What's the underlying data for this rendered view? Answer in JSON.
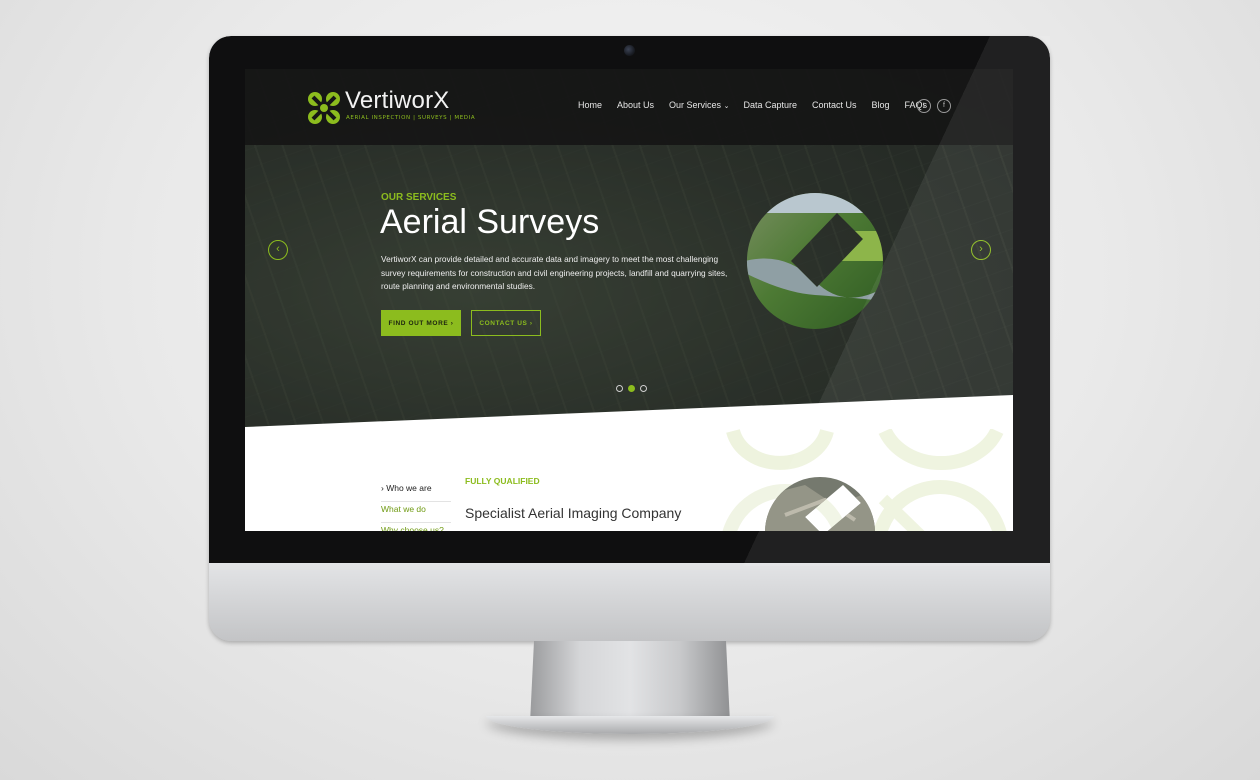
{
  "brand": {
    "name": "VertiworX",
    "tagline": "AERIAL INSPECTION | SURVEYS | MEDIA",
    "accent": "#8cbc1e"
  },
  "nav": {
    "items": [
      "Home",
      "About Us",
      "Our Services",
      "Data Capture",
      "Contact Us",
      "Blog",
      "FAQs"
    ],
    "services_dropdown_icon": "chevron-down-icon",
    "social": [
      "twitter-icon",
      "facebook-icon"
    ]
  },
  "hero": {
    "kicker": "OUR SERVICES",
    "title": "Aerial Surveys",
    "body": "VertiworX can provide detailed and accurate data and imagery to meet the most challenging survey requirements for construction and civil engineering projects, landfill and quarrying sites, route planning and environmental studies.",
    "primary_button": "FIND OUT MORE ›",
    "secondary_button": "CONTACT US ›",
    "prev_icon": "chevron-left-icon",
    "next_icon": "chevron-right-icon",
    "slides_total": 3,
    "active_slide": 2
  },
  "section": {
    "subnav": [
      "› Who we are",
      "What we do",
      "Why choose us?"
    ],
    "kicker": "FULLY QUALIFIED",
    "title": "Specialist Aerial Imaging Company"
  }
}
